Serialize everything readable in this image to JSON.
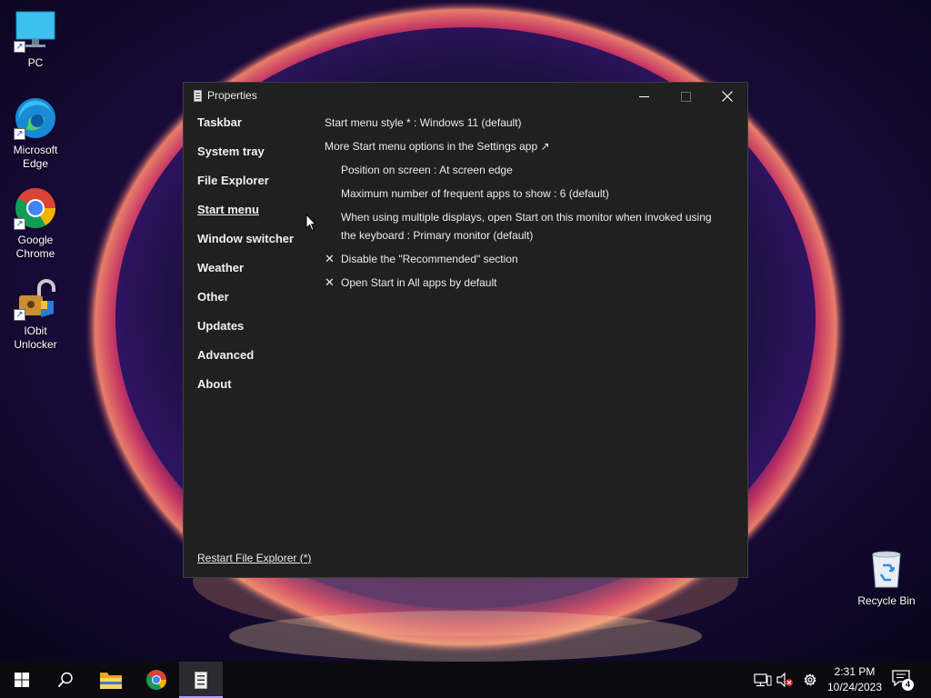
{
  "desktop": {
    "icons": [
      {
        "label_1": "PC",
        "label_2": ""
      },
      {
        "label_1": "Microsoft",
        "label_2": "Edge"
      },
      {
        "label_1": "Google",
        "label_2": "Chrome"
      },
      {
        "label_1": "IObit",
        "label_2": "Unlocker"
      }
    ],
    "recycle_bin": {
      "label": "Recycle Bin"
    }
  },
  "window": {
    "title": "Properties",
    "nav": [
      {
        "label": "Taskbar"
      },
      {
        "label": "System tray"
      },
      {
        "label": "File Explorer"
      },
      {
        "label": "Start menu",
        "active": true
      },
      {
        "label": "Window switcher"
      },
      {
        "label": "Weather"
      },
      {
        "label": "Other"
      },
      {
        "label": "Updates"
      },
      {
        "label": "Advanced"
      },
      {
        "label": "About"
      }
    ],
    "options": {
      "start_menu_style": "Start menu style * : Windows 11 (default)",
      "more_options": "More Start menu options in the Settings app ↗",
      "position": "Position on screen : At screen edge",
      "max_frequent": "Maximum number of frequent apps to show : 6 (default)",
      "multi_display_line1": "When using multiple displays, open Start on this monitor when invoked using",
      "multi_display_line2": "the keyboard : Primary monitor (default)",
      "check_mark": "✕",
      "disable_recommended": "Disable the \"Recommended\" section",
      "open_all_apps": "Open Start in All apps by default"
    },
    "restart_link": "Restart File Explorer (*)"
  },
  "taskbar": {
    "clock_time": "2:31 PM",
    "clock_date": "10/24/2023",
    "notification_count": "4"
  },
  "colors": {
    "window_bg": "#202020",
    "taskbar_bg": "#0b0b0f",
    "accent": "#b4a0ff"
  }
}
